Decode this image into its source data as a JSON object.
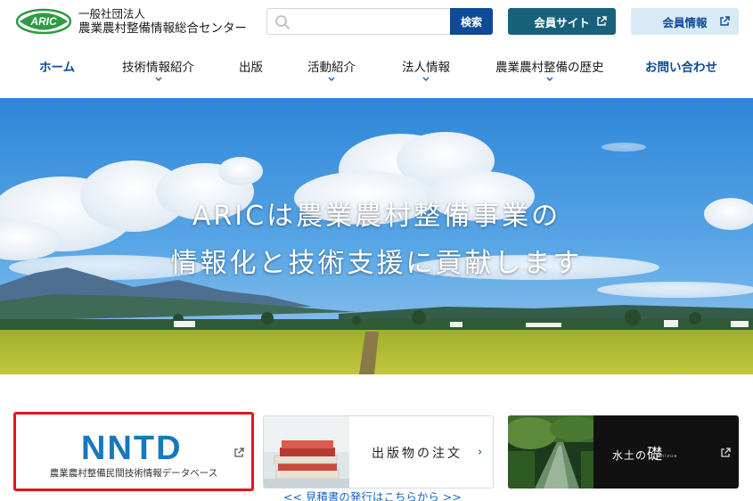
{
  "header": {
    "logo_text": "ARIC",
    "org_line1": "一般社団法人",
    "org_line2": "農業農村整備情報総合センター",
    "search_button": "検索",
    "search_placeholder": "",
    "member_site": "会員サイト",
    "member_info": "会員情報"
  },
  "nav": {
    "items": [
      {
        "label": "ホーム"
      },
      {
        "label": "技術情報紹介"
      },
      {
        "label": "出版"
      },
      {
        "label": "活動紹介"
      },
      {
        "label": "法人情報"
      },
      {
        "label": "農業農村整備の歴史"
      },
      {
        "label": "お問い合わせ"
      }
    ]
  },
  "hero": {
    "line1": "ARICは農業農村整備事業の",
    "line2": "情報化と技術支援に貢献します"
  },
  "banners": {
    "nntd_logo": "NNTD",
    "nntd_caption": "農業農村整備民間技術情報データベース",
    "pubs_title": "出版物の注文",
    "pubs_arrow": "›",
    "ishizue_title_small": "水土の",
    "ishizue_title_big": "礎",
    "ishizue_sub": "ishizue"
  },
  "estimate_link": "<< 見積書の発行はこちらから >>",
  "colors": {
    "primary": "#0d4a97",
    "teal": "#17627a",
    "light_blue": "#d8eaf6",
    "nntd_blue": "#1778bd",
    "highlight_red": "#e01818"
  }
}
